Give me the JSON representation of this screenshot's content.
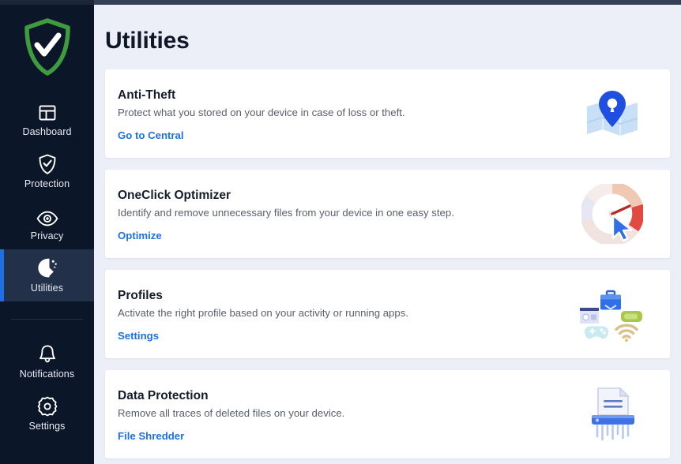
{
  "app": {
    "accent_blue": "#1f6fe5",
    "sidebar_bg": "#0b1628",
    "page_bg": "#eceff7",
    "active_bg": "#22304a"
  },
  "sidebar": {
    "logo": {
      "icon": "shield-check-logo",
      "color": "#3aa03a"
    },
    "items": [
      {
        "label": "Dashboard",
        "icon": "dashboard-icon",
        "active": false
      },
      {
        "label": "Protection",
        "icon": "shield-check-icon",
        "active": false
      },
      {
        "label": "Privacy",
        "icon": "eye-icon",
        "active": false
      },
      {
        "label": "Utilities",
        "icon": "utilities-icon",
        "active": true
      }
    ],
    "bottom_items": [
      {
        "label": "Notifications",
        "icon": "bell-icon",
        "active": false
      },
      {
        "label": "Settings",
        "icon": "gear-icon",
        "active": false
      }
    ]
  },
  "main": {
    "title": "Utilities",
    "cards": [
      {
        "title": "Anti-Theft",
        "description": "Protect what you stored on your device in case of loss or theft.",
        "link": "Go to Central",
        "art": "map-pin-lock-art"
      },
      {
        "title": "OneClick Optimizer",
        "description": "Identify and remove unnecessary files from your device in one easy step.",
        "link": "Optimize",
        "art": "gauge-cursor-art"
      },
      {
        "title": "Profiles",
        "description": "Activate the right profile based on your activity or running apps.",
        "link": "Settings",
        "art": "profiles-cluster-art"
      },
      {
        "title": "Data Protection",
        "description": "Remove all traces of deleted files on your device.",
        "link": "File Shredder",
        "art": "file-shredder-art"
      }
    ]
  }
}
